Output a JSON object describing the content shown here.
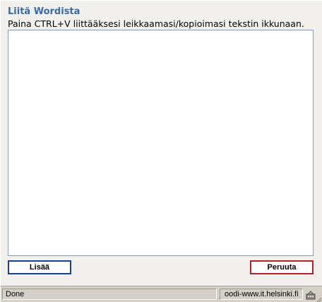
{
  "dialog": {
    "title": "Liitä Wordista",
    "instructions": "Paina CTRL+V liittääksesi leikkaamasi/kopioimasi tekstin ikkunaan.",
    "paste_area_value": ""
  },
  "buttons": {
    "add_label": "Lisää",
    "cancel_label": "Peruuta"
  },
  "statusbar": {
    "status_text": "Done",
    "host": "oodi-www.it.helsinki.fi",
    "icon": "security-zone-icon"
  },
  "colors": {
    "title": "#3a6aa6",
    "add_border": "#1c3f8e",
    "cancel_border": "#a8272c",
    "background": "#f1f0ec"
  }
}
